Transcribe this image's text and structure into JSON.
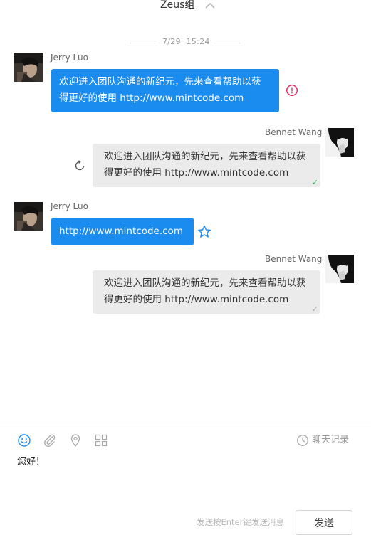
{
  "header": {
    "title": "Zeus组"
  },
  "timestamp": "7/29  15:24",
  "messages": [
    {
      "sender": "Jerry Luo",
      "side": "left",
      "line1": "欢迎进入团队沟通的新纪元，先来查看帮助以获",
      "line2": "得更好的使用 http://www.mintcode.com",
      "status": "error-icon"
    },
    {
      "sender": "Bennet Wang",
      "side": "right",
      "line1": "欢迎进入团队沟通的新纪元，先来查看帮助以获",
      "line2": "得更好的使用 http://www.mintcode.com",
      "status": "resend-icon",
      "check": "✓"
    },
    {
      "sender": "Jerry Luo",
      "side": "left",
      "line1": "http://www.mintcode.com",
      "status": "star-icon"
    },
    {
      "sender": "Bennet Wang",
      "side": "right",
      "line1": "欢迎进入团队沟通的新纪元，先来查看帮助以获",
      "line2": "得更好的使用 http://www.mintcode.com",
      "check": "✓"
    }
  ],
  "toolbar": {
    "icons": [
      "emoji-icon",
      "attachment-icon",
      "location-icon",
      "apps-grid-icon"
    ],
    "history_label": "聊天记录"
  },
  "composer": {
    "value": "您好！"
  },
  "footer": {
    "hint": "发送按Enter键发送消息",
    "send_label": "发送"
  },
  "colors": {
    "accent": "#1a8cf0",
    "bubble_gray": "#ebebeb",
    "error": "#e0245e",
    "read_check": "#2fb24a",
    "unread_check": "#b0b0b0"
  }
}
